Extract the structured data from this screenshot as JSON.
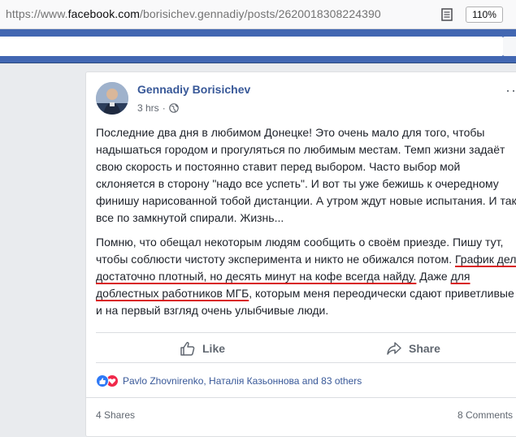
{
  "browser": {
    "url_prefix": "https://www.",
    "url_host": "facebook.com",
    "url_path": "/borisichev.gennadiy/posts/2620018308224390",
    "zoom": "110%"
  },
  "post": {
    "author": "Gennadiy Borisichev",
    "time": "3 hrs",
    "dot": "·",
    "paragraph1": "Последние два дня в любимом Донецке! Это очень мало для того, чтобы надышаться городом и прогуляться по любимым местам. Темп жизни задаёт свою скорость и постоянно ставит перед выбором. Часто выбор мой склоняется в сторону \"надо все успеть\". И вот ты уже бежишь к очередному финишу нарисованной тобой дистанции. А утром ждут новые испытания. И так все по замкнутой спирали. Жизнь...",
    "paragraph2_part1": "Помню, что обещал некоторым людям сообщить о своём приезде. Пишу тут, чтобы соблюсти чистоту эксперимента и никто не обижался потом.",
    "paragraph2_underlined1": "График дел достаточно плотный, но десять минут на кофе всегда найду.",
    "paragraph2_part2": "Даже",
    "paragraph2_underlined2": "для доблестных работников МГБ",
    "paragraph2_part3": ", которым меня переодически сдают приветливые и на первый взгляд очень улыбчивые люди.",
    "like_label": "Like",
    "share_label": "Share",
    "reactors": "Pavlo Zhovnirenko, Наталія Казьоннова and 83 others",
    "shares": "4 Shares",
    "comments": "8 Comments"
  },
  "colors": {
    "fb_blue": "#4267b2",
    "link_blue": "#385898",
    "annotation_red": "#d81b1b"
  },
  "icons": [
    "reader-view-icon",
    "globe-icon",
    "like-thumb-icon",
    "share-arrow-icon",
    "reaction-like-icon",
    "reaction-love-icon"
  ]
}
